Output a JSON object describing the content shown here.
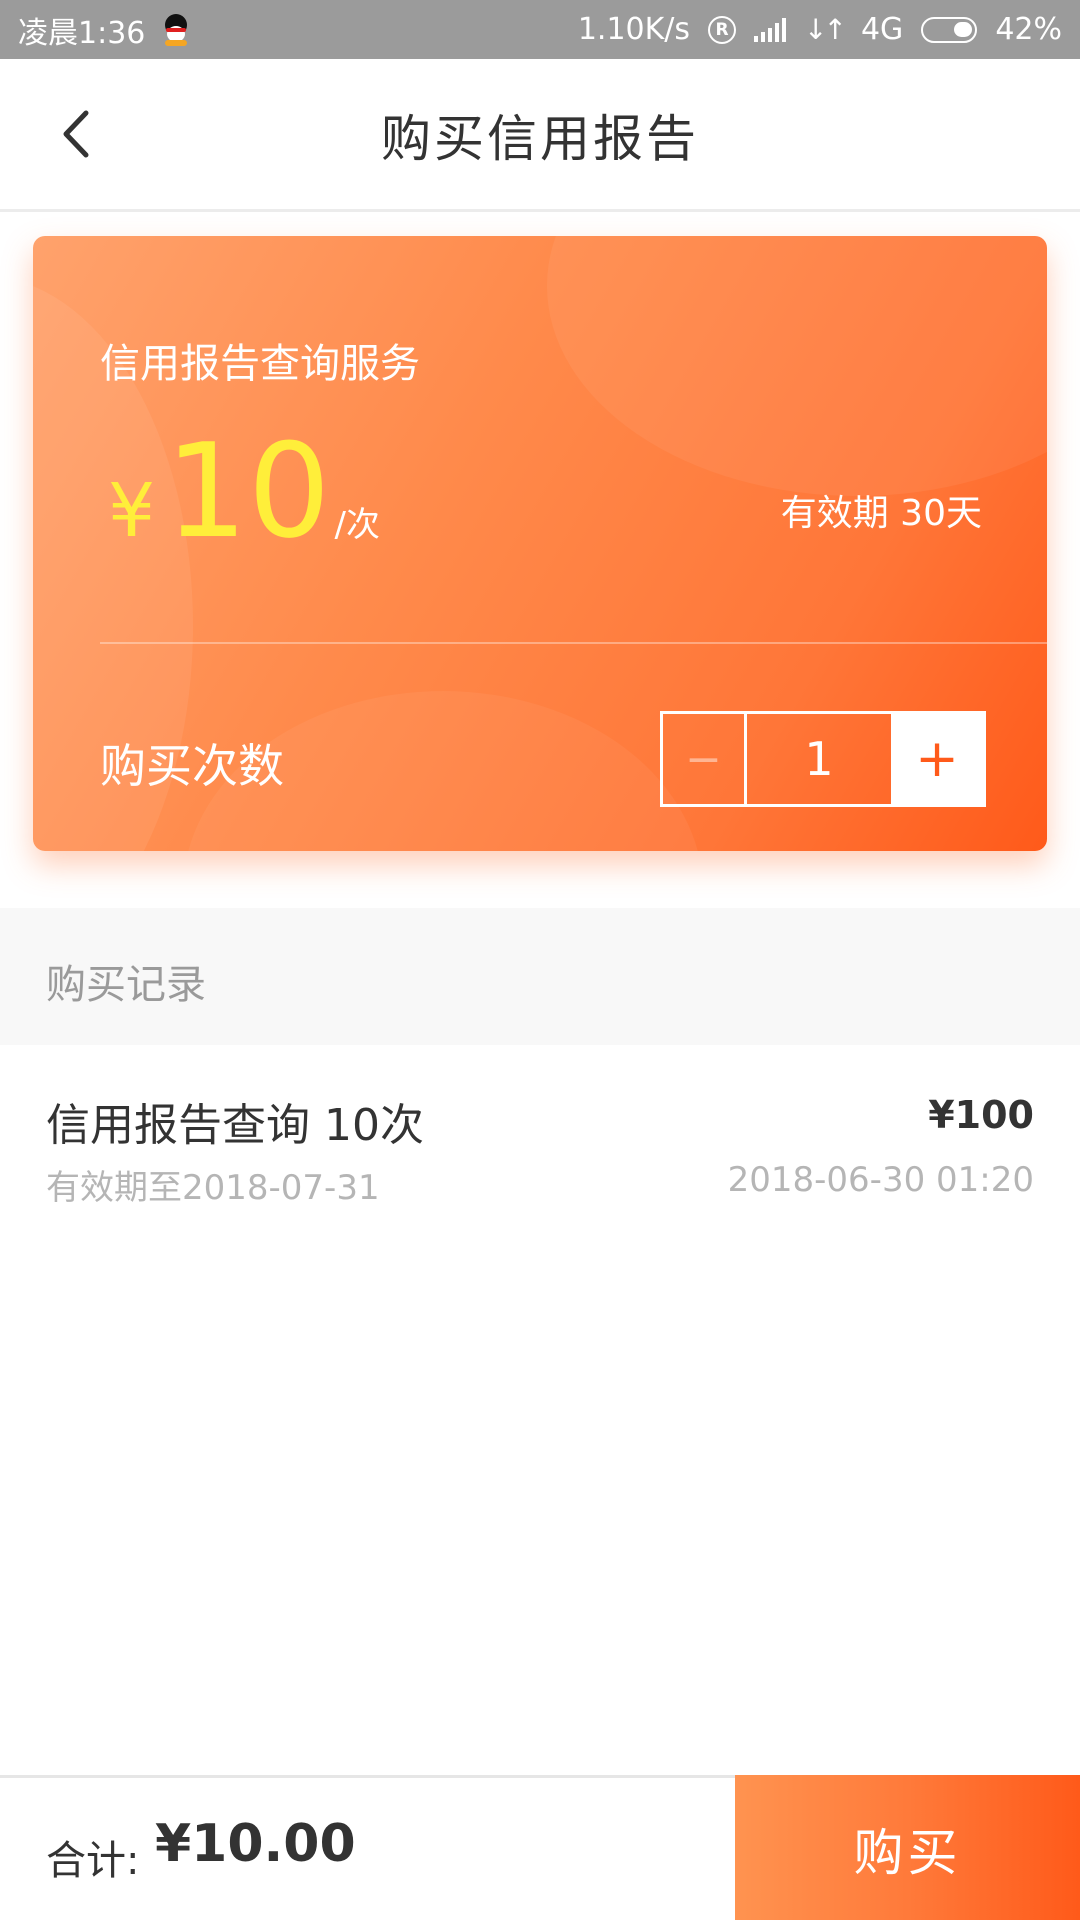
{
  "status_bar": {
    "time": "凌晨1:36",
    "speed": "1.10K/s",
    "reg_symbol": "R",
    "network": "4G",
    "battery": "42%"
  },
  "nav": {
    "title": "购买信用报告"
  },
  "card": {
    "service_name": "信用报告查询服务",
    "currency": "¥",
    "price": "10",
    "unit": "/次",
    "validity": "有效期 30天",
    "quantity_label": "购买次数",
    "stepper": {
      "minus": "−",
      "value": "1",
      "plus": "+"
    }
  },
  "records": {
    "title": "购买记录",
    "items": [
      {
        "name": "信用报告查询 10次",
        "price": "¥100",
        "expiry": "有效期至2018-07-31",
        "time": "2018-06-30 01:20"
      }
    ]
  },
  "bottom": {
    "total_label": "合计:",
    "total_amount": "¥10.00",
    "buy_label": "购买"
  },
  "colors": {
    "accent": "#ff7638",
    "price_yellow": "#ffee3a",
    "status_bar": "#9b9b9b"
  }
}
